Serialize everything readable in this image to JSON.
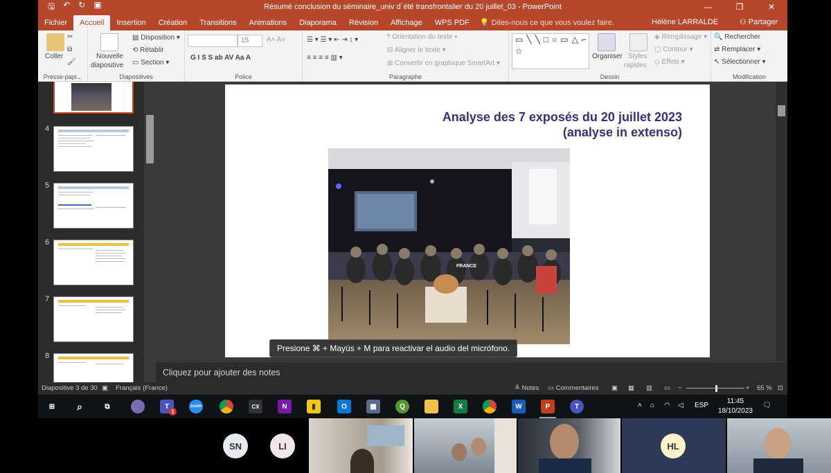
{
  "titlebar": {
    "doc_title": "Résumé conclusion du séminaire_univ d´été transfrontalier du 20 juillet_03 - PowerPoint",
    "qat": [
      "save-icon",
      "undo-icon",
      "redo-icon",
      "present-icon"
    ],
    "window_controls": [
      "—",
      "❐",
      "✕"
    ]
  },
  "tabs": [
    "Fichier",
    "Accueil",
    "Insertion",
    "Création",
    "Transitions",
    "Animations",
    "Diaporama",
    "Révision",
    "Affichage",
    "WPS PDF"
  ],
  "active_tab": "Accueil",
  "tellme": "Dites-nous ce que vous voulez faire.",
  "user": "Hélène LARRALDE",
  "share": "Partager",
  "ribbon": {
    "presse_papiers": {
      "label": "Presse-papi...",
      "coller": "Coller"
    },
    "diapositives": {
      "label": "Diapositives",
      "nouvelle_line1": "Nouvelle",
      "nouvelle_line2": "diapositive",
      "disposition": "Disposition",
      "retablir": "Rétablir",
      "section": "Section"
    },
    "police": {
      "label": "Police",
      "size": "15",
      "format_buttons": "G  I  S  S  ab  AV  Aa  A"
    },
    "paragraphe": {
      "label": "Paragraphe",
      "orientation": "Orientation du texte",
      "aligner": "Aligner le texte",
      "convertir": "Convertir en graphique SmartArt"
    },
    "dessin": {
      "label": "Dessin",
      "organiser": "Organiser",
      "styles_line1": "Styles",
      "styles_line2": "rapides",
      "remplissage": "Remplissage",
      "contour": "Contour",
      "effets": "Effets"
    },
    "modification": {
      "label": "Modification",
      "rechercher": "Rechercher",
      "remplacer": "Remplacer",
      "selectionner": "Sélectionner"
    }
  },
  "thumbnails": [
    {
      "num": "",
      "selected": true
    },
    {
      "num": "4",
      "selected": false
    },
    {
      "num": "5",
      "selected": false
    },
    {
      "num": "6",
      "selected": false
    },
    {
      "num": "7",
      "selected": false
    },
    {
      "num": "8",
      "selected": false
    }
  ],
  "slide": {
    "title_line1": "Analyse des 7 exposés du 20 juillet 2023",
    "title_line2": "(analyse in extenso)",
    "photo_caption": "FRANCE"
  },
  "tooltip": "Presione ⌘ + Mayús + M para reactivar el audio del micrófono.",
  "notes_placeholder": "Cliquez pour ajouter des notes",
  "statusbar": {
    "slide_info": "Diapositive 3 de 30",
    "language": "Français (France)",
    "notes": "Notes",
    "comments": "Commentaires",
    "zoom": "65 %",
    "zoom_level": 0.5
  },
  "taskbar": {
    "icons": [
      "windows-icon",
      "search-icon",
      "taskview-icon",
      "app-icon",
      "teams-icon",
      "zoom-icon",
      "chrome-icon",
      "cx-icon",
      "onenote-icon",
      "powerbi-icon",
      "outlook-icon",
      "calculator-icon",
      "qgis-icon",
      "explorer-icon",
      "excel-icon",
      "chrome-icon",
      "word-icon",
      "powerpoint-icon",
      "teams2-icon"
    ],
    "cx_label": "CX",
    "teams_badge": "1",
    "language": "ESP",
    "time": "11:45",
    "date": "18/10/2023"
  },
  "participants": [
    {
      "initials": "SN",
      "color": "#e6e9ee"
    },
    {
      "initials": "LI",
      "color": "#f3e6ea"
    },
    {
      "initials": "HL",
      "color": "#fdf3c8"
    }
  ]
}
